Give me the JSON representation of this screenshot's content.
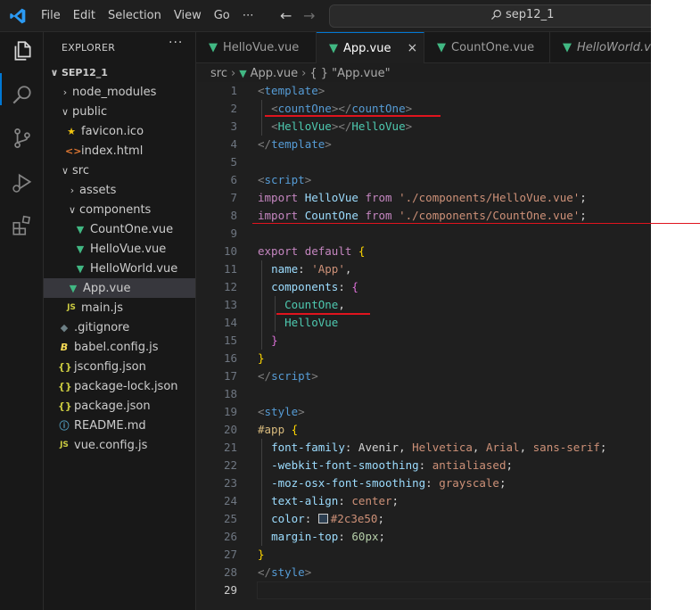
{
  "menu": {
    "items": [
      "File",
      "Edit",
      "Selection",
      "View",
      "Go"
    ],
    "more": "⋯"
  },
  "search": {
    "text": "sep12_1"
  },
  "explorer": {
    "header": "EXPLORER",
    "more": "···",
    "project": "SEP12_1",
    "items": [
      {
        "label": "node_modules",
        "kind": "folder",
        "open": false
      },
      {
        "label": "public",
        "kind": "folder",
        "open": true
      },
      {
        "label": "favicon.ico",
        "kind": "favicon"
      },
      {
        "label": "index.html",
        "kind": "html"
      },
      {
        "label": "src",
        "kind": "folder",
        "open": true
      },
      {
        "label": "assets",
        "kind": "folder",
        "open": false
      },
      {
        "label": "components",
        "kind": "folder",
        "open": true
      },
      {
        "label": "CountOne.vue",
        "kind": "vue"
      },
      {
        "label": "HelloVue.vue",
        "kind": "vue"
      },
      {
        "label": "HelloWorld.vue",
        "kind": "vue"
      },
      {
        "label": "App.vue",
        "kind": "vue",
        "selected": true
      },
      {
        "label": "main.js",
        "kind": "js"
      },
      {
        "label": ".gitignore",
        "kind": "git"
      },
      {
        "label": "babel.config.js",
        "kind": "babel"
      },
      {
        "label": "jsconfig.json",
        "kind": "json"
      },
      {
        "label": "package-lock.json",
        "kind": "json"
      },
      {
        "label": "package.json",
        "kind": "json"
      },
      {
        "label": "README.md",
        "kind": "info"
      },
      {
        "label": "vue.config.js",
        "kind": "js"
      }
    ]
  },
  "tabs": [
    {
      "label": "HelloVue.vue",
      "active": false
    },
    {
      "label": "App.vue",
      "active": true,
      "close": "×"
    },
    {
      "label": "CountOne.vue",
      "active": false
    },
    {
      "label": "HelloWorld.vue",
      "active": false
    }
  ],
  "breadcrumb": {
    "folder": "src",
    "file": "App.vue",
    "symbol": "{ } \"App.vue\""
  },
  "editor": {
    "line_numbers": [
      "1",
      "2",
      "3",
      "4",
      "5",
      "6",
      "7",
      "8",
      "9",
      "10",
      "11",
      "12",
      "13",
      "14",
      "15",
      "16",
      "17",
      "18",
      "19",
      "20",
      "21",
      "22",
      "23",
      "24",
      "25",
      "26",
      "27",
      "28",
      "29"
    ],
    "current_line": "29",
    "code": {
      "l1": [
        "<",
        "template",
        ">"
      ],
      "l2": [
        "<",
        "countOne",
        "></",
        "countOne",
        ">"
      ],
      "l3": [
        "<",
        "HelloVue",
        "></",
        "HelloVue",
        ">"
      ],
      "l4": [
        "</",
        "template",
        ">"
      ],
      "l6": [
        "<",
        "script",
        ">"
      ],
      "l7": [
        "import",
        "HelloVue",
        "from",
        "'./components/HelloVue.vue'",
        ";"
      ],
      "l8": [
        "import",
        "CountOne",
        "from",
        "'./components/CountOne.vue'",
        ";"
      ],
      "l10": [
        "export",
        "default",
        "{"
      ],
      "l11": [
        "name",
        ": ",
        "'App'",
        ","
      ],
      "l12": [
        "components",
        ": ",
        "{"
      ],
      "l13": [
        "CountOne",
        ","
      ],
      "l14": [
        "HelloVue"
      ],
      "l15": [
        "}"
      ],
      "l16": [
        "}"
      ],
      "l17": [
        "</",
        "script",
        ">"
      ],
      "l19": [
        "<",
        "style",
        ">"
      ],
      "l20": [
        "#app",
        "{"
      ],
      "l21": [
        "font-family",
        ": ",
        "Avenir",
        ", ",
        "Helvetica",
        ", ",
        "Arial",
        ", ",
        "sans-serif",
        ";"
      ],
      "l22": [
        "-webkit-font-smoothing",
        ": ",
        "antialiased",
        ";"
      ],
      "l23": [
        "-moz-osx-font-smoothing",
        ": ",
        "grayscale",
        ";"
      ],
      "l24": [
        "text-align",
        ": ",
        "center",
        ";"
      ],
      "l25": [
        "color",
        ": ",
        "#2c3e50",
        ";"
      ],
      "l26": [
        "margin-top",
        ": ",
        "60px",
        ";"
      ],
      "l27": [
        "}"
      ],
      "l28": [
        "</",
        "style",
        ">"
      ]
    }
  },
  "colors": {
    "accent": "#0078d4",
    "annotation": "#e0141e",
    "swatch": "#2c3e50"
  }
}
